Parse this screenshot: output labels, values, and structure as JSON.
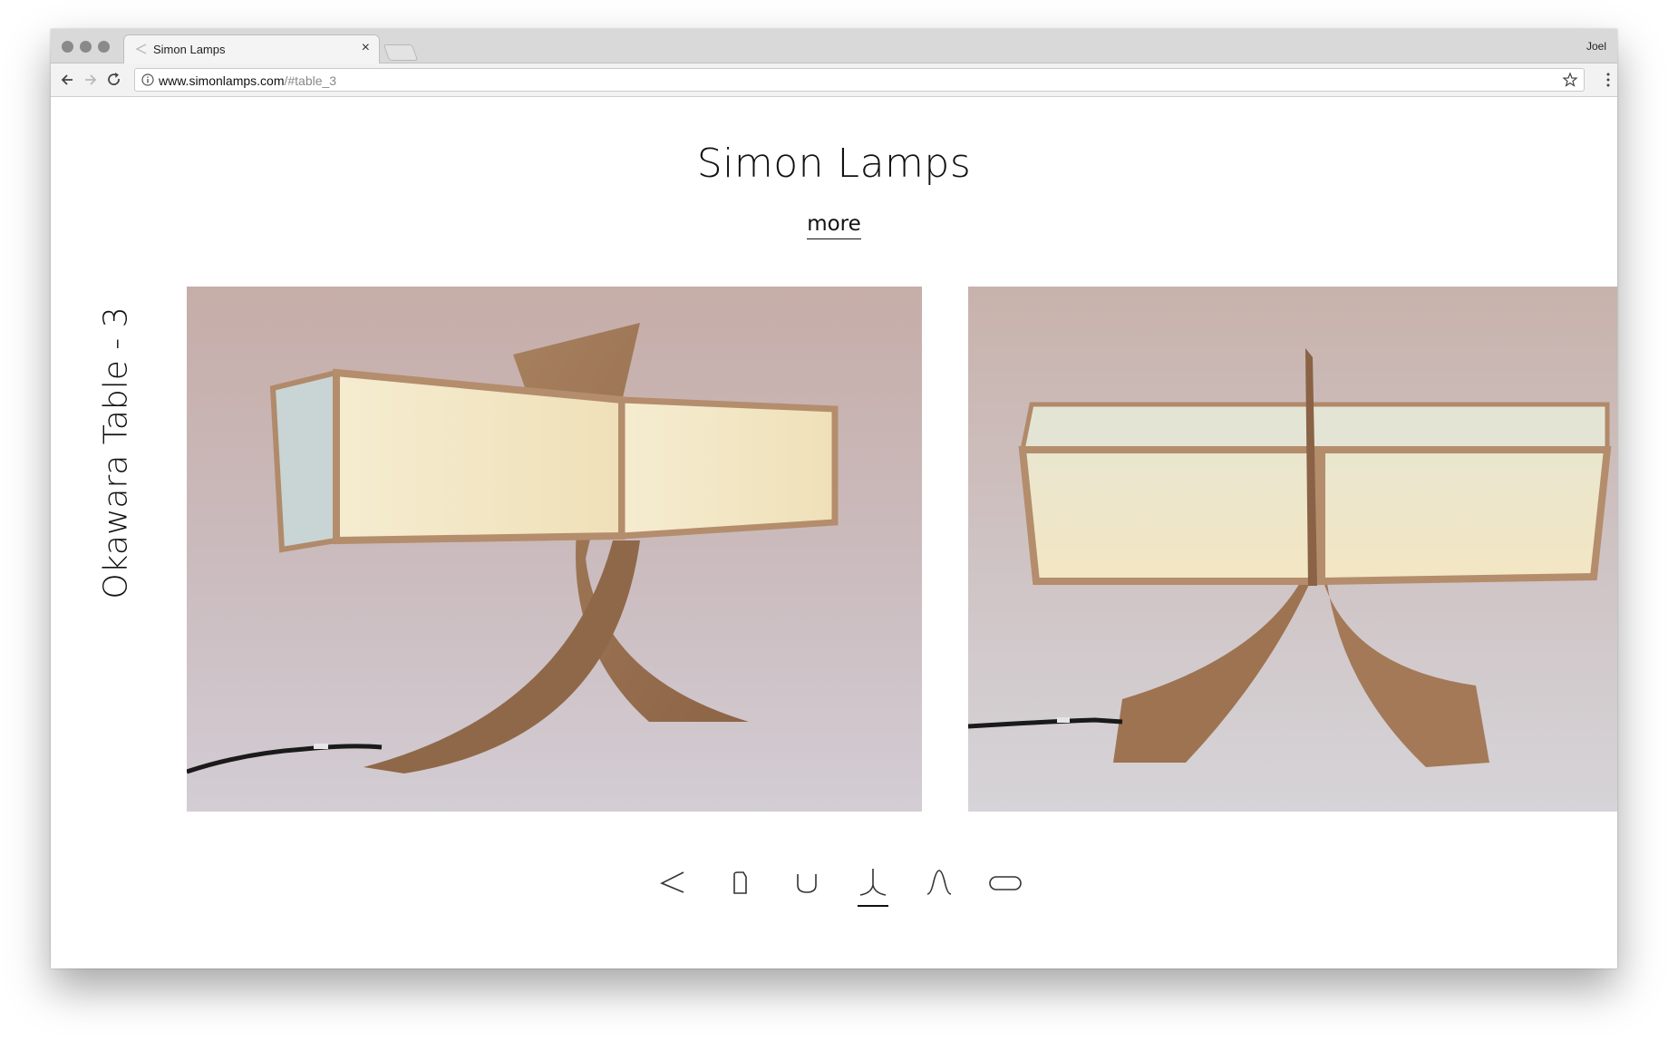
{
  "browser": {
    "tab_title": "Simon Lamps",
    "tab_close": "×",
    "profile_name": "Joel",
    "url_host": "www.simonlamps.com",
    "url_path": "/#table_3"
  },
  "page": {
    "title": "Simon Lamps",
    "more_link": "more",
    "lamp_label": "Okawara Table - 3"
  },
  "thumbnails": [
    {
      "name": "shape-angle-icon",
      "active": false
    },
    {
      "name": "shape-tall-box-icon",
      "active": false
    },
    {
      "name": "shape-cup-icon",
      "active": false
    },
    {
      "name": "shape-table-icon",
      "active": true
    },
    {
      "name": "shape-arch-icon",
      "active": false
    },
    {
      "name": "shape-pill-icon",
      "active": false
    }
  ],
  "colors": {
    "photo_bg": "#c9b5b3",
    "wood": "#9c7351",
    "shade": "#f1e6c6"
  }
}
